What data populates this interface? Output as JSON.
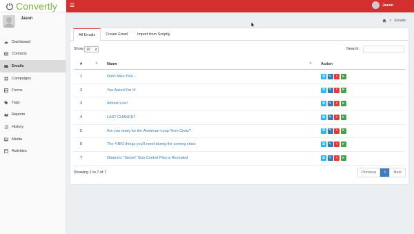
{
  "app": {
    "name": "Convertly",
    "brand_color": "#7cb342",
    "header_color": "#d32f2f"
  },
  "user": {
    "name": "Jason"
  },
  "sidebar": {
    "items": [
      {
        "label": "Dashboard",
        "icon": "dashboard-icon"
      },
      {
        "label": "Contacts",
        "icon": "contacts-icon"
      },
      {
        "label": "Emails",
        "icon": "email-icon",
        "active": true
      },
      {
        "label": "Campaigns",
        "icon": "campaigns-icon"
      },
      {
        "label": "Forms",
        "icon": "forms-icon"
      },
      {
        "label": "Tags",
        "icon": "tags-icon"
      },
      {
        "label": "Reports",
        "icon": "reports-icon"
      },
      {
        "label": "History",
        "icon": "history-icon"
      },
      {
        "label": "Media",
        "icon": "media-icon"
      },
      {
        "label": "Activities",
        "icon": "activities-icon"
      }
    ]
  },
  "breadcrumb": {
    "sep": ">",
    "current": "Emails"
  },
  "tabs": [
    "All Emails",
    "Create Email",
    "Import from Scriptly"
  ],
  "table_controls": {
    "show_label": "Show",
    "show_value": "10",
    "search_label": "Search:"
  },
  "table": {
    "headers": {
      "num": "#",
      "name": "Name",
      "action": "Action"
    },
    "rows": [
      {
        "num": "1",
        "name": "Don't Miss This..."
      },
      {
        "num": "2",
        "name": "You Asked For It!"
      },
      {
        "num": "3",
        "name": "Almost Live!"
      },
      {
        "num": "4",
        "name": "LAST CHANCE!!"
      },
      {
        "num": "5",
        "name": "Are you ready for the American Long-Term Crisis?"
      },
      {
        "num": "6",
        "name": "The 4 BIG things you’ll need during the coming crisis"
      },
      {
        "num": "7",
        "name": "Obama's \"Secret\" Gun Control Plan is Revealed"
      }
    ]
  },
  "footer": {
    "showing": "Showing 1 to 7 of 7",
    "prev": "Previous",
    "page": "1",
    "next": "Next"
  }
}
